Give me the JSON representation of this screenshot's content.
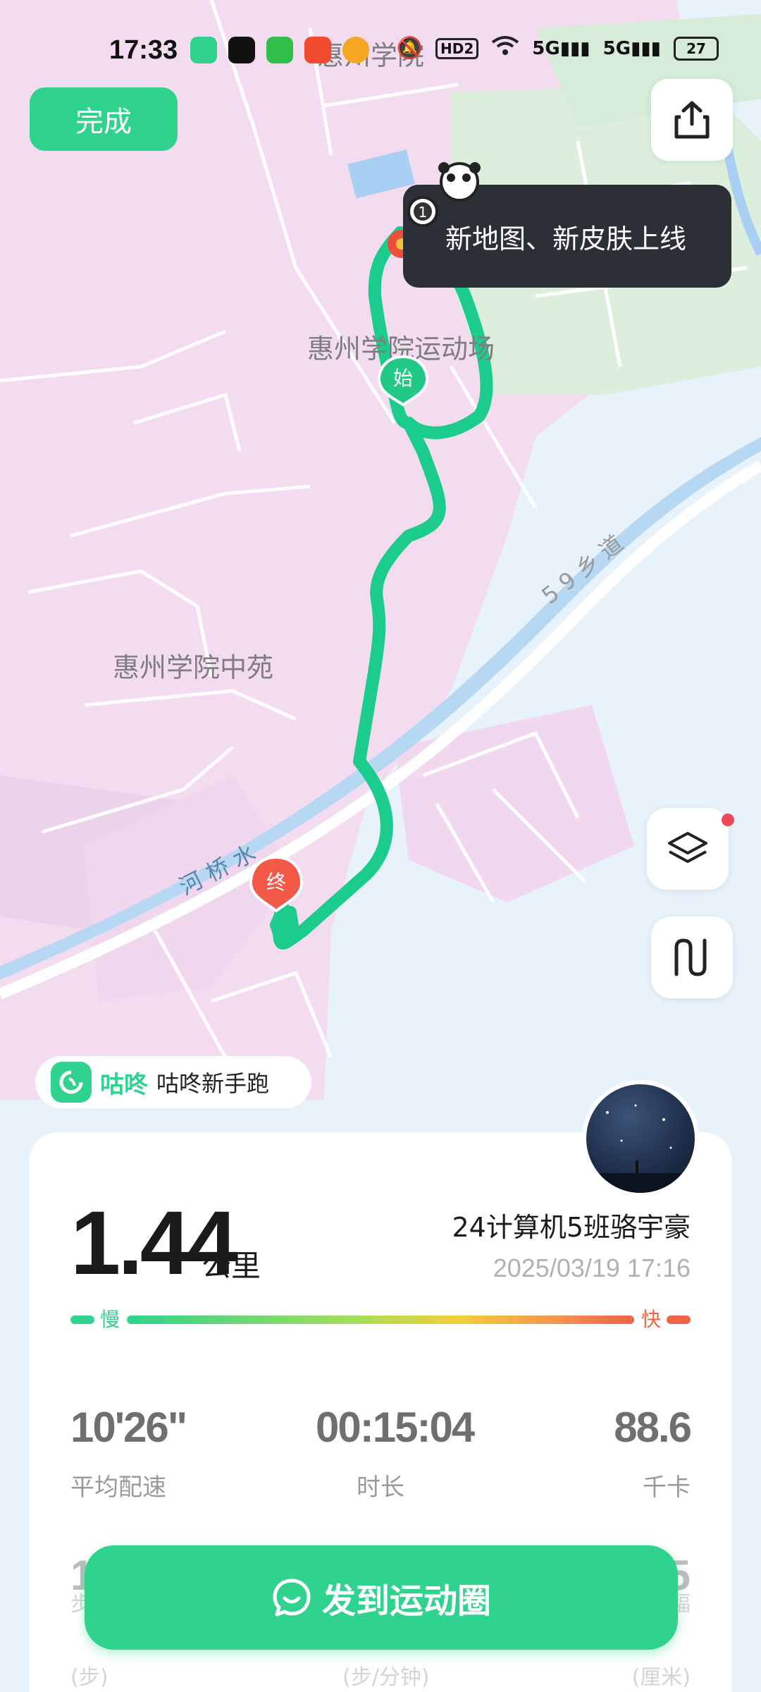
{
  "status_bar": {
    "time": "17:33",
    "network_badges": [
      "HD2",
      "5G",
      "5G"
    ],
    "battery": "27"
  },
  "map": {
    "labels": {
      "campus_top": "惠州学院",
      "sports_field": "惠州学院运动场",
      "middle_court": "惠州学院中苑",
      "river": "河 桥 水",
      "road": "5 9 乡 道"
    },
    "start_marker": "始",
    "end_marker": "终",
    "route_color": "#1ccc8d"
  },
  "toolbar": {
    "done_label": "完成"
  },
  "tooltip": {
    "text": "新地图、新皮肤上线",
    "badge": "1"
  },
  "brand": {
    "name": "咕咚",
    "subtitle": "咕咚新手跑"
  },
  "summary": {
    "distance": "1.44",
    "distance_unit": "公里",
    "user_name": "24计算机5班骆宇豪",
    "date": "2025/03/19 17:16",
    "pace_slow": "慢",
    "pace_fast": "快"
  },
  "metrics": [
    {
      "value": "10'26\"",
      "label": "平均配速"
    },
    {
      "value": "00:15:04",
      "label": "时长"
    },
    {
      "value": "88.6",
      "label": "千卡"
    }
  ],
  "faint_metrics": {
    "left_value": "1",
    "left_label": "步",
    "left_sub": "(步)",
    "center_sub": "(步/分钟)",
    "right_value": "5",
    "right_label": "幅",
    "right_sub": "(厘米)"
  },
  "post_button": {
    "label": "发到运动圈"
  },
  "colors": {
    "accent": "#2fd38d",
    "fast": "#f16246",
    "map_pink": "#f4dcf1",
    "map_water": "#b7d8f2"
  }
}
